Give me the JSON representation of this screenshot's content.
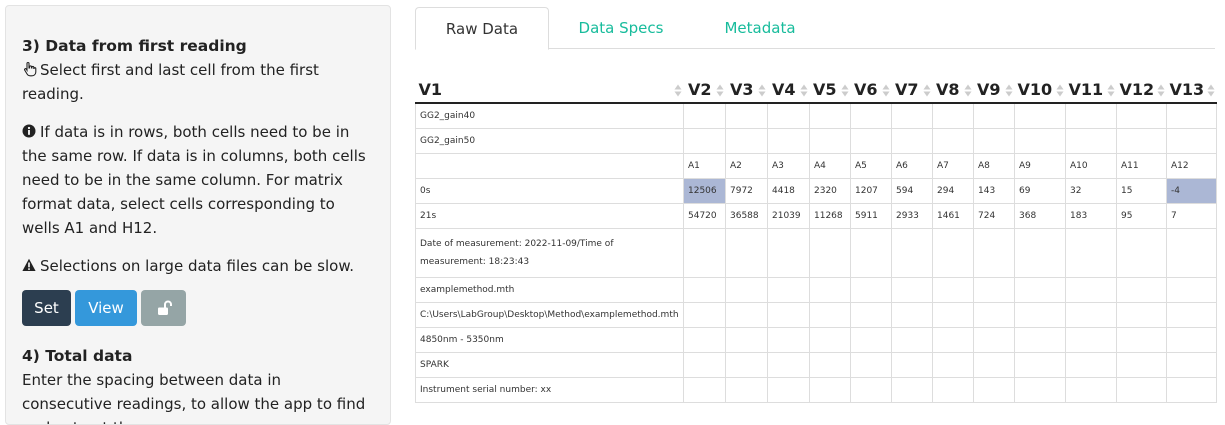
{
  "sidebar": {
    "section3_title": "3) Data from first reading",
    "section3_instruction": "Select first and last cell from the first reading.",
    "info_text": "If data is in rows, both cells need to be in the same row. If data is in columns, both cells need to be in the same column. For matrix format data, select cells corresponding to wells A1 and H12.",
    "warning_text": "Selections on large data files can be slow.",
    "buttons": {
      "set": "Set",
      "view": "View"
    },
    "section4_title": "4) Total data",
    "section4_text": "Enter the spacing between data in consecutive readings, to allow the app to find and extract the"
  },
  "tabs": [
    "Raw Data",
    "Data Specs",
    "Metadata"
  ],
  "table": {
    "headers": [
      "V1",
      "V2",
      "V3",
      "V4",
      "V5",
      "V6",
      "V7",
      "V8",
      "V9",
      "V10",
      "V11",
      "V12",
      "V13"
    ],
    "rows": [
      [
        "GG2_gain40",
        "",
        "",
        "",
        "",
        "",
        "",
        "",
        "",
        "",
        "",
        "",
        ""
      ],
      [
        "GG2_gain50",
        "",
        "",
        "",
        "",
        "",
        "",
        "",
        "",
        "",
        "",
        "",
        ""
      ],
      [
        "",
        "A1",
        "A2",
        "A3",
        "A4",
        "A5",
        "A6",
        "A7",
        "A8",
        "A9",
        "A10",
        "A11",
        "A12"
      ],
      [
        "0s",
        "12506",
        "7972",
        "4418",
        "2320",
        "1207",
        "594",
        "294",
        "143",
        "69",
        "32",
        "15",
        "-4"
      ],
      [
        "21s",
        "54720",
        "36588",
        "21039",
        "11268",
        "5911",
        "2933",
        "1461",
        "724",
        "368",
        "183",
        "95",
        "7"
      ],
      [
        "Date of measurement: 2022-11-09/Time of measurement: 18:23:43",
        "",
        "",
        "",
        "",
        "",
        "",
        "",
        "",
        "",
        "",
        "",
        ""
      ],
      [
        "examplemethod.mth",
        "",
        "",
        "",
        "",
        "",
        "",
        "",
        "",
        "",
        "",
        "",
        ""
      ],
      [
        "C:\\Users\\LabGroup\\Desktop\\Method\\examplemethod.mth",
        "",
        "",
        "",
        "",
        "",
        "",
        "",
        "",
        "",
        "",
        "",
        ""
      ],
      [
        "4850nm - 5350nm",
        "",
        "",
        "",
        "",
        "",
        "",
        "",
        "",
        "",
        "",
        "",
        ""
      ],
      [
        "SPARK",
        "",
        "",
        "",
        "",
        "",
        "",
        "",
        "",
        "",
        "",
        "",
        ""
      ],
      [
        "Instrument serial number: xx",
        "",
        "",
        "",
        "",
        "",
        "",
        "",
        "",
        "",
        "",
        "",
        ""
      ]
    ],
    "selected_color": "#abb7d5"
  },
  "colors": {
    "dark": "#2c3e50",
    "primary": "#3498db",
    "muted": "#95a5a6",
    "tab_accent": "#18bc9c"
  },
  "icons": {
    "instruction": "hand-pointer-icon",
    "info": "info-circle-icon",
    "warning": "warning-triangle-icon",
    "lock": "unlock-icon",
    "sort": "sort-icon"
  }
}
